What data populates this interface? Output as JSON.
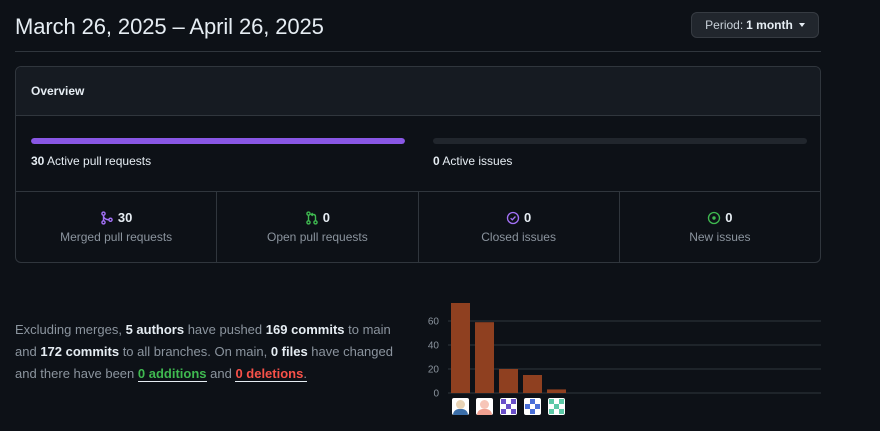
{
  "header": {
    "title": "March 26, 2025 – April 26, 2025",
    "period_prefix": "Period:",
    "period_value": "1 month"
  },
  "overview": {
    "title": "Overview",
    "active_pull_requests": {
      "count": "30",
      "label": "Active pull requests",
      "fill_fraction": 1.0,
      "color": "#8957e5"
    },
    "active_issues": {
      "count": "0",
      "label": "Active issues",
      "fill_fraction": 0.0
    },
    "stats": [
      {
        "icon": "merged-pr-icon",
        "value": "30",
        "label": "Merged pull requests",
        "color": "#a371f7"
      },
      {
        "icon": "open-pr-icon",
        "value": "0",
        "label": "Open pull requests",
        "color": "#3fb950"
      },
      {
        "icon": "closed-issue-icon",
        "value": "0",
        "label": "Closed issues",
        "color": "#a371f7"
      },
      {
        "icon": "new-issue-icon",
        "value": "0",
        "label": "New issues",
        "color": "#3fb950"
      }
    ]
  },
  "summary": {
    "t1": "Excluding merges, ",
    "authors": "5 authors",
    "t2": " have pushed ",
    "commits": "169 commits",
    "t3": " to main and ",
    "commits_all": "172 commits",
    "t4": " to all branches. On main, ",
    "files": "0 files",
    "t5": " have changed and there have been ",
    "additions": "0 additions",
    "t6": " and ",
    "deletions": "0 deletions",
    "t7": "."
  },
  "chart_data": {
    "type": "bar",
    "categories": [
      "author-1",
      "author-2",
      "author-3",
      "author-4",
      "author-5"
    ],
    "values": [
      75,
      59,
      20,
      15,
      3
    ],
    "yticks": [
      "0",
      "20",
      "40",
      "60"
    ],
    "ylim": [
      0,
      75
    ],
    "bar_color": "#8f4020",
    "grid": true
  },
  "avatars": [
    {
      "icon": "avatar-icon-1"
    },
    {
      "icon": "avatar-icon-2"
    },
    {
      "icon": "avatar-icon-3"
    },
    {
      "icon": "avatar-icon-4"
    },
    {
      "icon": "avatar-icon-5"
    }
  ]
}
